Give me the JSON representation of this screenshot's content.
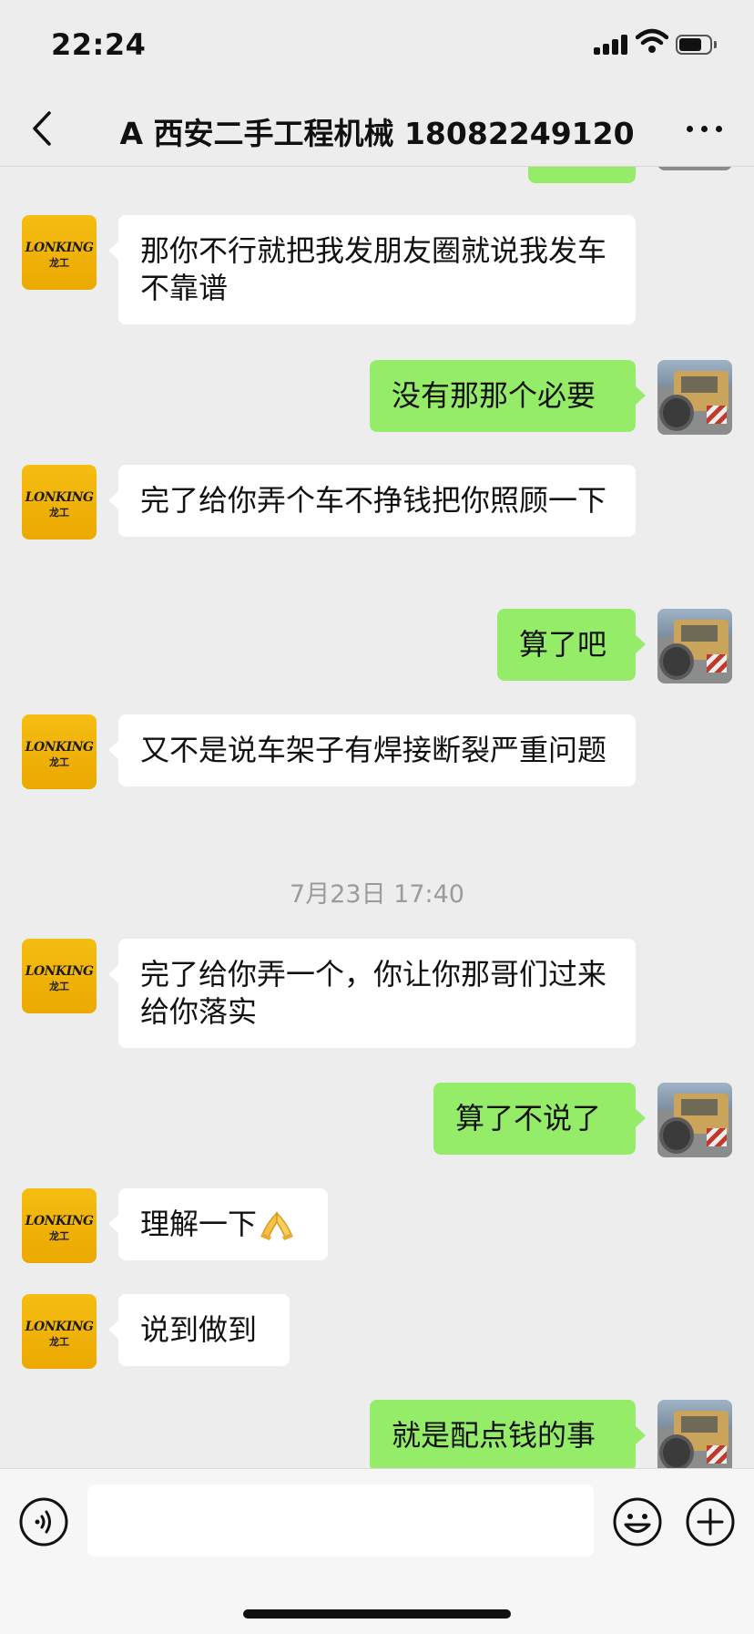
{
  "status_bar": {
    "time": "22:24"
  },
  "nav": {
    "title": "A 西安二手工程机械 18082249120"
  },
  "contact_avatar": {
    "brand_text": "LONKING",
    "brand_cn": "龙工"
  },
  "timestamp": "7月23日 17:40",
  "messages": [
    {
      "side": "left",
      "text": "那你不行就把我发朋友圈就说我发车不靠谱"
    },
    {
      "side": "right",
      "text": "没有那那个必要"
    },
    {
      "side": "left",
      "text": "完了给你弄个车不挣钱把你照顾一下"
    },
    {
      "side": "right",
      "text": "算了吧"
    },
    {
      "side": "left",
      "text": "又不是说车架子有焊接断裂严重问题"
    },
    {
      "side": "left",
      "text": "完了给你弄一个，你让你那哥们过来给你落实"
    },
    {
      "side": "right",
      "text": "算了不说了"
    },
    {
      "side": "left",
      "text": "理解一下",
      "emoji": "folded-hands"
    },
    {
      "side": "left",
      "text": "说到做到"
    },
    {
      "side": "right",
      "text": "就是配点钱的事"
    }
  ],
  "colors": {
    "background": "#ededed",
    "bubble_self": "#95ec69",
    "bubble_other": "#ffffff",
    "timestamp": "#9b9b9b"
  },
  "input": {
    "value": "",
    "placeholder": ""
  }
}
